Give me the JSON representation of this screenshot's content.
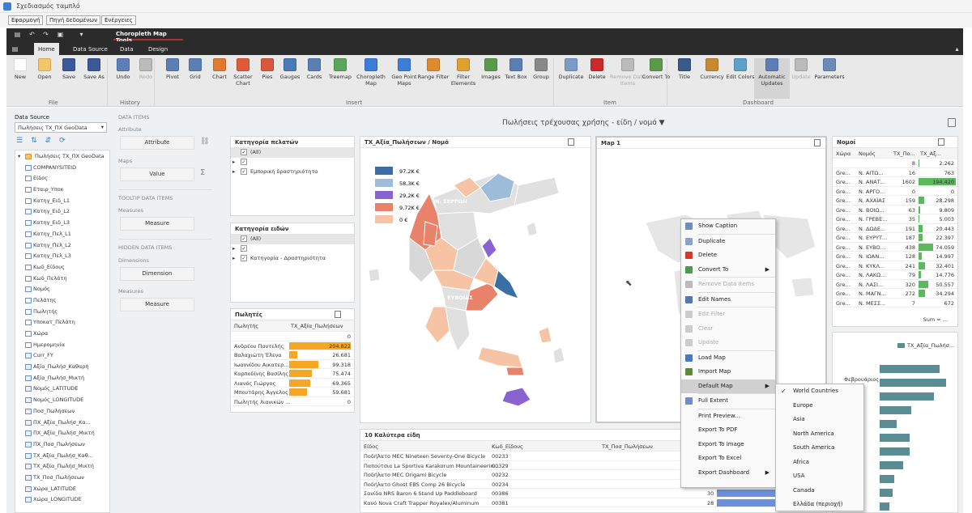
{
  "window": {
    "title": "Σχεδιασμός ταμπλό"
  },
  "menu": [
    "Εφαρμογή",
    "Πηγή δεδομένων",
    "Ενέργειες"
  ],
  "context_tab": "Choropleth Map Tools",
  "tabs": [
    "Home",
    "Data Source",
    "Data",
    "Design"
  ],
  "ribbon": {
    "buttons": [
      "New",
      "Open",
      "Save",
      "Save As",
      "Undo",
      "Redo",
      "Pivot",
      "Grid",
      "Chart",
      "Scatter Chart",
      "Pies",
      "Gauges",
      "Cards",
      "Treemap",
      "Choropleth Map",
      "Geo Point Maps",
      "Range Filter",
      "Filter Elements",
      "Images",
      "Text Box",
      "Group",
      "Duplicate",
      "Delete",
      "Remove Data Items",
      "Convert To",
      "Title",
      "Currency",
      "Edit Colors",
      "Automatic Updates",
      "Update",
      "Parameters"
    ],
    "groups": [
      "File",
      "History",
      "Insert",
      "Item",
      "Dashboard"
    ]
  },
  "datasource": {
    "label": "Data Source",
    "selected": "Πωλήσεις ΤΧ_ΠΧ GeoData",
    "root": "Πωλήσεις ΤΧ_ΠΧ GeoData",
    "fields": [
      "COMPANYSITEID",
      "Είδος",
      "Εταιρ_Υποκ",
      "Κατηγ_Ειδ_L1",
      "Κατηγ_Ειδ_L2",
      "Κατηγ_Ειδ_L3",
      "Κατηγ_Πελ_L1",
      "Κατηγ_Πελ_L2",
      "Κατηγ_Πελ_L3",
      "Κωδ_Είδους",
      "Κωδ_Πελάτη",
      "Νομός",
      "Πελάτης",
      "Πωλητής",
      "Υποκατ_Πελάτη",
      "Χώρα",
      "Ημερομηνία",
      "Curr_FY",
      "Αξία_Πωλήσ_Καθαρή",
      "Αξία_Πωλήσ_Μικτή",
      "Νομός_LATITUDE",
      "Νομός_LONGITUDE",
      "Ποσ_Πωλήσεων",
      "ΠΧ_Αξία_Πωλήσ_Κα...",
      "ΠΧ_Αξία_Πωλήσ_Μικτή",
      "ΠΧ_Ποσ_Πωλήσεων",
      "ΤΧ_Αξία_Πωλήσ_Καθ...",
      "ΤΧ_Αξία_Πωλήσ_Μικτή",
      "ΤΧ_Ποσ_Πωλήσεων",
      "Χώρα_LATITUDE",
      "Χώρα_LONGITUDE"
    ]
  },
  "bins": {
    "data_items": "DATA ITEMS",
    "attribute": "Attribute",
    "attribute_btn": "Attribute",
    "maps": "Maps",
    "value_btn": "Value",
    "tooltip": "TOOLTIP DATA ITEMS",
    "measures": "Measures",
    "measure_btn": "Measure",
    "hidden": "HIDDEN DATA ITEMS",
    "dimensions": "Dimensions",
    "dimension_btn": "Dimension",
    "measures2": "Measures",
    "measure_btn2": "Measure"
  },
  "dashboard_title": "Πωλήσεις τρέχουσας χρήσης - είδη / νομό",
  "filter1": {
    "title": "Κατηγορία πελατών",
    "items": [
      "(All)",
      "",
      "Εμπορική δραστηριότητα"
    ]
  },
  "filter2": {
    "title": "Κατηγορία ειδών",
    "items": [
      "(All)",
      "",
      "Κατηγορία - Δραστηριότητα"
    ]
  },
  "sales": {
    "title": "Πωλητές",
    "col1": "Πωλητής",
    "col2": "ΤΧ_Αξία_Πωλήσεων",
    "rows": [
      {
        "name": "",
        "value": "0",
        "pct": 0
      },
      {
        "name": "Ανδρέου Παντελής",
        "value": "204.822",
        "pct": 1.0
      },
      {
        "name": "Βαλαχιώτη Έλενα",
        "value": "26.681",
        "pct": 0.13
      },
      {
        "name": "Ιωαννίδου Αικατερ...",
        "value": "99.318",
        "pct": 0.48
      },
      {
        "name": "Καρποδίνης Βασίλης",
        "value": "75.474",
        "pct": 0.37
      },
      {
        "name": "Λιανός Γιώργος",
        "value": "69.365",
        "pct": 0.34
      },
      {
        "name": "Μπουτάρης Άγγελος",
        "value": "59.681",
        "pct": 0.29
      },
      {
        "name": "Πωλητής λιανικών ...",
        "value": "0",
        "pct": 0
      }
    ]
  },
  "map": {
    "title": "ΤΧ_Αξία_Πωλήσεων / Νομό",
    "legend": [
      "97,2K €",
      "58,3K €",
      "29,2K €",
      "9,72K €",
      "0 €"
    ],
    "legend_colors": [
      "#3a6ea5",
      "#9dbcd9",
      "#8a63d2",
      "#e8826a",
      "#f6c4a4"
    ],
    "labels": [
      "Ν. ΣΕΡΡΩΝ",
      "Ν. ΦΘΙΩΤΙΔΑΣ",
      "Ν. ΕΥΒΟΙΑΣ"
    ]
  },
  "map1": {
    "title": "Map 1"
  },
  "context_menu": [
    {
      "label": "Show Caption",
      "dis": false,
      "icon": "caption-icon",
      "color": "#6b8fc2"
    },
    {
      "label": "Duplicate",
      "dis": false,
      "icon": "duplicate-icon",
      "color": "#8aa3c8"
    },
    {
      "label": "Delete",
      "dis": false,
      "icon": "delete-icon",
      "color": "#d43a2a"
    },
    {
      "label": "Convert To",
      "dis": false,
      "icon": "convert-icon",
      "color": "#4b9a4b",
      "sub": true
    },
    {
      "label": "Remove Data Items",
      "dis": true,
      "icon": "remove-data-icon",
      "color": "#bbb"
    },
    {
      "label": "Edit Names",
      "dis": false,
      "icon": "edit-names-icon",
      "color": "#5577aa"
    },
    {
      "label": "Edit Filter",
      "dis": true,
      "icon": "filter-icon",
      "color": "#ccc"
    },
    {
      "label": "Clear",
      "dis": true,
      "icon": "clear-icon",
      "color": "#ccc"
    },
    {
      "label": "Update",
      "dis": true,
      "icon": "update-icon",
      "color": "#ccc"
    },
    {
      "label": "Load Map",
      "dis": false,
      "icon": "load-map-icon",
      "color": "#4a7ab8"
    },
    {
      "label": "Import Map",
      "dis": false,
      "icon": "import-map-icon",
      "color": "#5b8a3a"
    },
    {
      "label": "Default Map",
      "dis": false,
      "icon": "default-map-icon",
      "color": "transparent",
      "sub": true,
      "hl": true
    },
    {
      "label": "Full Extent",
      "dis": false,
      "icon": "full-extent-icon",
      "color": "#6b8fc2"
    },
    {
      "label": "Print Preview...",
      "dis": false,
      "icon": "",
      "color": "transparent"
    },
    {
      "label": "Export To PDF",
      "dis": false,
      "icon": "",
      "color": "transparent"
    },
    {
      "label": "Export To Image",
      "dis": false,
      "icon": "",
      "color": "transparent"
    },
    {
      "label": "Export To Excel",
      "dis": false,
      "icon": "",
      "color": "transparent"
    },
    {
      "label": "Export Dashboard",
      "dis": false,
      "icon": "",
      "color": "transparent",
      "sub": true
    }
  ],
  "submenu": [
    {
      "label": "World Countries",
      "checked": true
    },
    {
      "label": "Europe",
      "checked": false
    },
    {
      "label": "Asia",
      "checked": false
    },
    {
      "label": "North America",
      "checked": false
    },
    {
      "label": "South America",
      "checked": false
    },
    {
      "label": "Africa",
      "checked": false
    },
    {
      "label": "USA",
      "checked": false
    },
    {
      "label": "Canada",
      "checked": false
    },
    {
      "label": "Ελλάδα (περιοχή)",
      "checked": false
    }
  ],
  "nomoi": {
    "title": "Νομοί",
    "cols": [
      "Χώρα",
      "Νομός",
      "ΤΧ_Πο...",
      "ΤΧ_Αξ..."
    ],
    "rows": [
      [
        "",
        "",
        "8",
        "2.262",
        0.012
      ],
      [
        "Gre...",
        "Ν. ΑΙΤΩ...",
        "16",
        "763",
        0.004
      ],
      [
        "Gre...",
        "Ν. ΑΝΑΤ...",
        "1602",
        "194.420",
        1.0
      ],
      [
        "Gre...",
        "Ν. ΑΡΓΟ...",
        "0",
        "0",
        0
      ],
      [
        "Gre...",
        "Ν. ΑΧΑΪΑΣ",
        "159",
        "28.298",
        0.146
      ],
      [
        "Gre...",
        "Ν. ΒΟΙΩ...",
        "63",
        "9.809",
        0.05
      ],
      [
        "Gre...",
        "Ν. ΓΡΕΒΕ...",
        "35",
        "5.003",
        0.026
      ],
      [
        "Gre...",
        "Ν. ΔΩΔΕ...",
        "191",
        "20.443",
        0.105
      ],
      [
        "Gre...",
        "Ν. ΕΥΡΥΤ...",
        "187",
        "22.397",
        0.115
      ],
      [
        "Gre...",
        "Ν. ΕΥΒΟ...",
        "438",
        "74.059",
        0.381
      ],
      [
        "Gre...",
        "Ν. ΙΩΑΝ...",
        "128",
        "14.997",
        0.077
      ],
      [
        "Gre...",
        "Ν. ΚΥΚΛ...",
        "241",
        "32.401",
        0.167
      ],
      [
        "Gre...",
        "Ν. ΛΑΚΩ...",
        "79",
        "14.776",
        0.076
      ],
      [
        "Gre...",
        "Ν. ΛΑΣΙ...",
        "320",
        "50.557",
        0.26
      ],
      [
        "Gre...",
        "Ν. ΜΑΓΝ...",
        "272",
        "34.294",
        0.176
      ],
      [
        "Gre...",
        "Ν. ΜΕΣΣ...",
        "7",
        "672",
        0.003
      ]
    ],
    "sum": "Sum = ..."
  },
  "top10": {
    "title": "10 Καλύτερα είδη",
    "cols": [
      "Είδος",
      "Κωδ_Είδους",
      "ΤΧ_Ποσ_Πωλήσεων"
    ],
    "rows": [
      [
        "Ποδήλατο MEC Nineteen Seventy-One Bicycle",
        "00233",
        ""
      ],
      [
        "Παπούτσια La Sportiva Karakorum Mountaineerin...",
        "00329",
        ""
      ],
      [
        "Ποδήλατο MEC Origami Bicycle",
        "00232",
        ""
      ],
      [
        "Ποδήλατο Ghost EBS Comp 26 Bicycle",
        "00234",
        "51"
      ],
      [
        "Σανίδα NRS Baron 6 Stand Up Paddleboard",
        "00386",
        "30"
      ],
      [
        "Κανό Nova Craft Trapper Royalex/Aluminum",
        "00381",
        "28"
      ]
    ]
  },
  "monthly": {
    "legend": "ΤΧ_Αξία_Πωλήσ...",
    "month_label": "Φεβρουάριος",
    "color": "#5a8c93",
    "values": [
      90,
      100,
      82,
      48,
      25,
      45,
      45,
      35,
      22,
      20,
      15,
      12
    ]
  }
}
